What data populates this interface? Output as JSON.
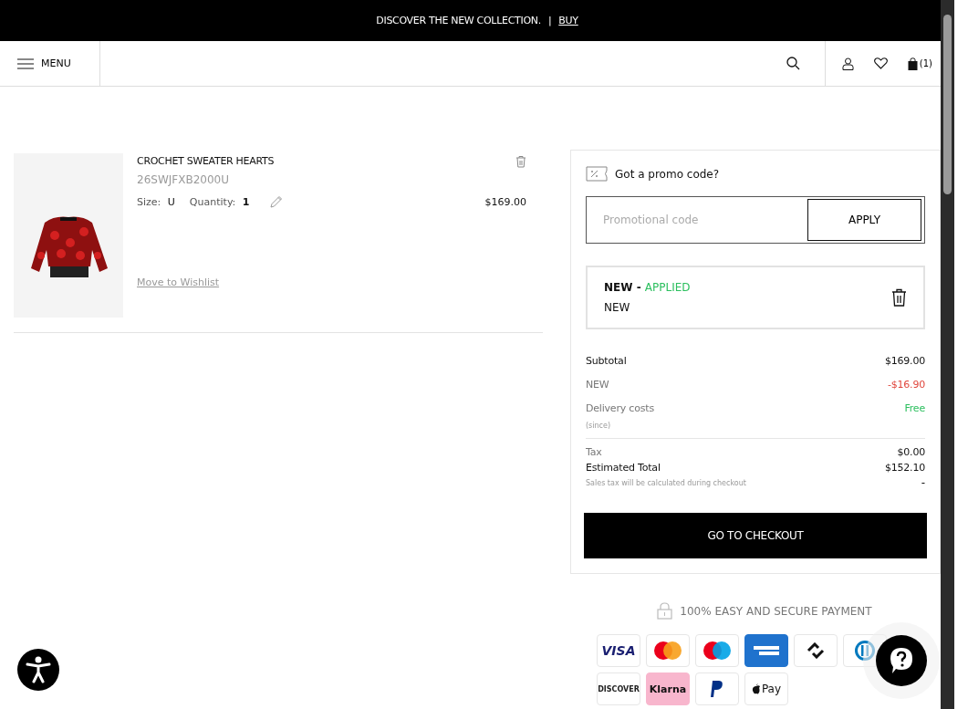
{
  "announcement": {
    "text": "DISCOVER THE NEW COLLECTION.",
    "separator": "|",
    "link": "BUY"
  },
  "header": {
    "menu_label": "MENU",
    "cart_count": "(1)"
  },
  "cart_items": [
    {
      "name": "CROCHET SWEATER HEARTS",
      "sku": "26SWJFXB2000U",
      "size_label": "Size:",
      "size": "U",
      "quantity_label": "Quantity:",
      "quantity": "1",
      "price": "$169.00",
      "wishlist_link": "Move to Wishlist"
    }
  ],
  "promo": {
    "title": "Got a promo code?",
    "placeholder": "Promotional code",
    "apply_button": "APPLY",
    "applied": [
      {
        "code": "NEW",
        "separator": "-",
        "status": "APPLIED",
        "description": "NEW"
      }
    ]
  },
  "summary": {
    "lines": [
      {
        "label": "Subtotal",
        "value": "$169.00",
        "kind": "normal"
      },
      {
        "label": "NEW",
        "value": "-$16.90",
        "kind": "discount"
      },
      {
        "label": "Delivery costs",
        "value": "Free",
        "note": "(since)",
        "kind": "free"
      }
    ],
    "totals": [
      {
        "label": "Tax",
        "value": "$0.00",
        "kind": "muted"
      },
      {
        "label": "Estimated Total",
        "value": "$152.10",
        "kind": "total"
      }
    ],
    "note": "Sales tax will be calculated during checkout",
    "note_value": "-"
  },
  "checkout_button": "GO TO CHECKOUT",
  "payment": {
    "title": "100% EASY AND  SECURE PAYMENT",
    "methods": [
      {
        "kind": "visa",
        "label": "VISA"
      },
      {
        "kind": "mastercard"
      },
      {
        "kind": "maestro"
      },
      {
        "kind": "amex"
      },
      {
        "kind": "chain"
      },
      {
        "kind": "diners"
      },
      {
        "kind": "discover",
        "label": "DISCOVER"
      },
      {
        "kind": "klarna",
        "label": "Klarna"
      },
      {
        "kind": "paypal"
      },
      {
        "kind": "applepay",
        "label": "Pay"
      }
    ]
  }
}
